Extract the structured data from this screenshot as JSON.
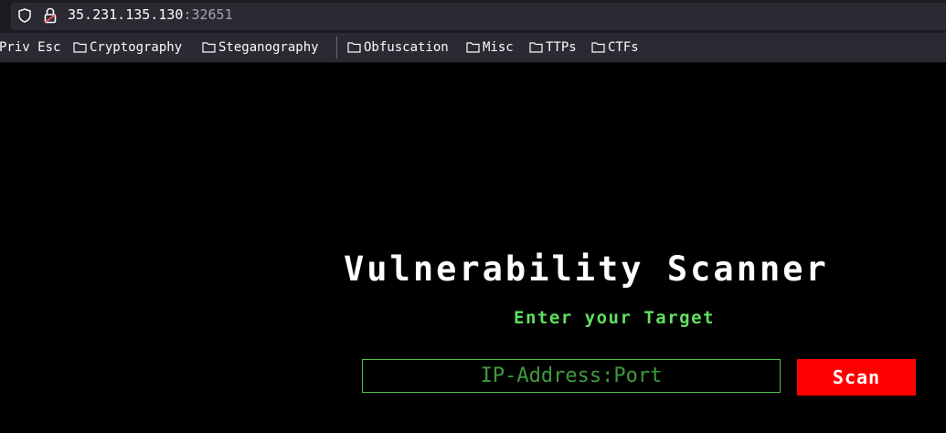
{
  "browser": {
    "url_host": "35.231.135.130",
    "url_port": ":32651",
    "icons": [
      "shield-icon",
      "lock-icon",
      "folder-icon"
    ]
  },
  "bookmarks": [
    {
      "label": "Priv Esc",
      "has_folder_icon": false
    },
    {
      "label": "Cryptography",
      "has_folder_icon": true
    },
    {
      "label": "Steganography",
      "has_folder_icon": true
    },
    {
      "label": "Obfuscation",
      "has_folder_icon": true
    },
    {
      "label": "Misc",
      "has_folder_icon": true
    },
    {
      "label": "TTPs",
      "has_folder_icon": true
    },
    {
      "label": "CTFs",
      "has_folder_icon": true
    }
  ],
  "page": {
    "title": "Vulnerability Scanner",
    "subtitle": "Enter your Target",
    "target_input": {
      "value": "",
      "placeholder": "IP-Address:Port"
    },
    "scan_label": "Scan"
  },
  "colors": {
    "background": "#000000",
    "title": "#ffffff",
    "accent_green": "#60e060",
    "scan_button": "#ff0000"
  }
}
